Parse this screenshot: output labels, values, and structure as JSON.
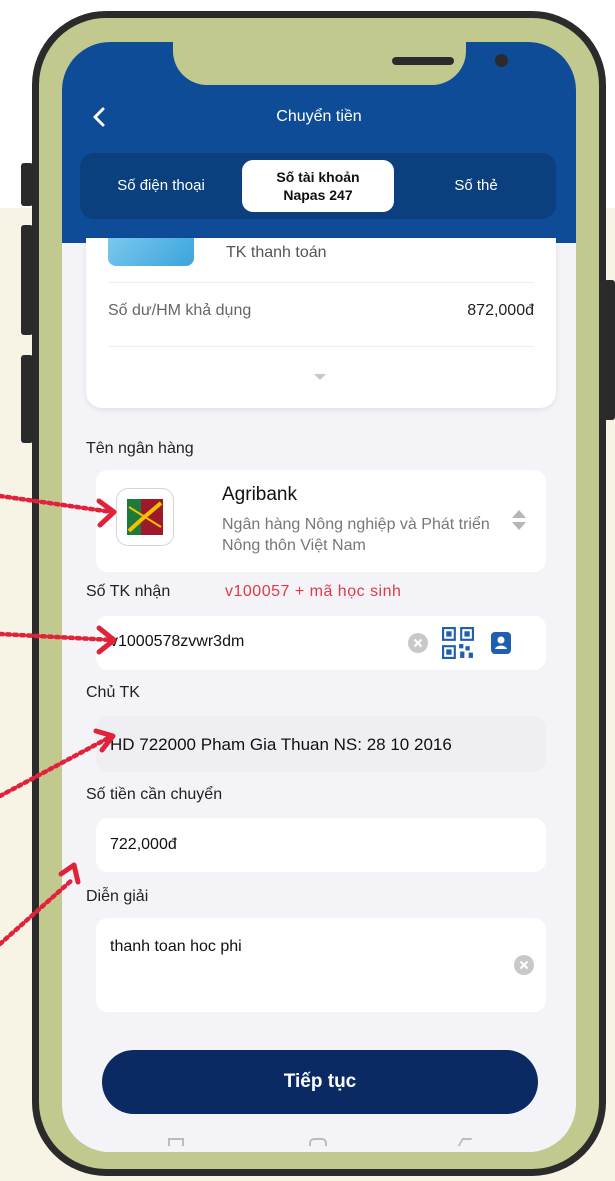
{
  "header": {
    "title": "Chuyển tiền",
    "tabs": [
      {
        "label": "Số điện thoại"
      },
      {
        "label": "Số tài khoản Napas 247",
        "active": true
      },
      {
        "label": "Số thẻ"
      }
    ]
  },
  "account": {
    "type": "TK thanh toán",
    "balance_label": "Số dư/HM khả dụng",
    "balance_value": "872,000đ"
  },
  "bank": {
    "label": "Tên ngân hàng",
    "name": "Agribank",
    "full_name": "Ngân hàng Nông nghiệp và Phát triển Nông thôn Việt Nam"
  },
  "recipient": {
    "label": "Số TK nhận",
    "hint": "v100057 + mã học sinh",
    "value": "v1000578zvwr3dm"
  },
  "holder": {
    "label": "Chủ TK",
    "value": "HD 722000 Pham Gia Thuan NS: 28 10 2016"
  },
  "amount": {
    "label": "Số tiền cần chuyển",
    "value": "722,000đ"
  },
  "description": {
    "label": "Diễn giải",
    "value": "thanh toan hoc phi"
  },
  "actions": {
    "continue_label": "Tiếp tục"
  },
  "colors": {
    "header_blue": "#0f4c97",
    "button_navy": "#0b2a63",
    "hint_red": "#e03a48",
    "frame_olive": "#c2c98e"
  }
}
